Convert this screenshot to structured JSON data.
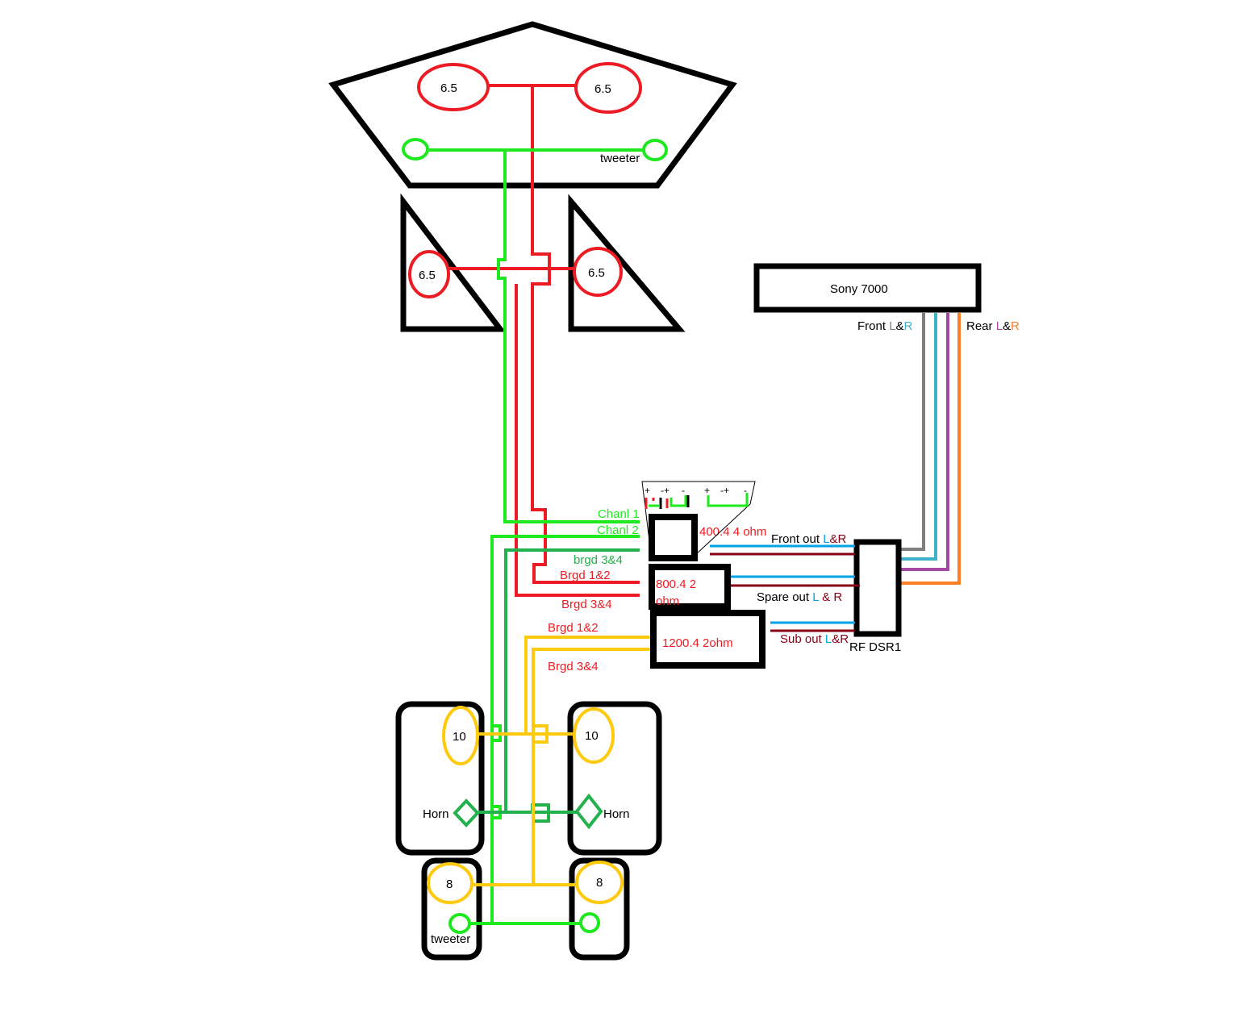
{
  "colors": {
    "red": "#ed1c24",
    "green": "#1ee81e",
    "dark_green": "#22b14c",
    "yellow": "#ffc90e",
    "blue": "#00a2e8",
    "dark_red": "#880015",
    "gray": "#7f7f7f",
    "teal": "#3fb1c8",
    "purple": "#a349a4",
    "orange": "#ff7f27"
  },
  "speakers": {
    "front_left": "6.5",
    "front_right": "6.5",
    "tweeter_label_top": "tweeter",
    "door_left": "6.5",
    "door_right": "6.5",
    "sub_left": "10",
    "sub_right": "10",
    "horn_left": "Horn",
    "horn_right": "Horn",
    "low_left": "8",
    "low_right": "8",
    "tweeter_label_bottom": "tweeter"
  },
  "head_unit": {
    "name": "Sony 7000",
    "front_label": "Front ",
    "front_l": "L",
    "amp": "&",
    "front_r": "R",
    "rear_label": "Rear ",
    "rear_l": "L",
    "rear_amp": "&",
    "rear_r": "R"
  },
  "dsp": {
    "name": "RF DSR1",
    "front_out": "Front out  ",
    "front_out_l": "L",
    "front_out_r": "&R",
    "spare_out": "Spare out ",
    "spare_out_l": "L",
    "spare_out_r": " & R",
    "sub_out": "Sub out ",
    "sub_out_l": "L",
    "sub_out_r": "&R"
  },
  "amps": {
    "amp1": "400.4 4 ohm",
    "amp2_line1": "800.4 2",
    "amp2_line2": "ohm",
    "amp3": "1200.4  2ohm"
  },
  "wire_labels": {
    "chanl1": "Chanl 1",
    "chanl2": "Chanl 2",
    "brgd34_green": "brgd 3&4",
    "brgd12_red": "Brgd 1&2",
    "brgd34_red": "Brgd 3&4",
    "brgd12_yellow": "Brgd  1&2",
    "brgd34_yellow": "Brgd 3&4"
  },
  "terminals": {
    "t1": "+",
    "t2": "-+",
    "t3": "-",
    "t4": "+",
    "t5": "-+",
    "t6": "-"
  }
}
